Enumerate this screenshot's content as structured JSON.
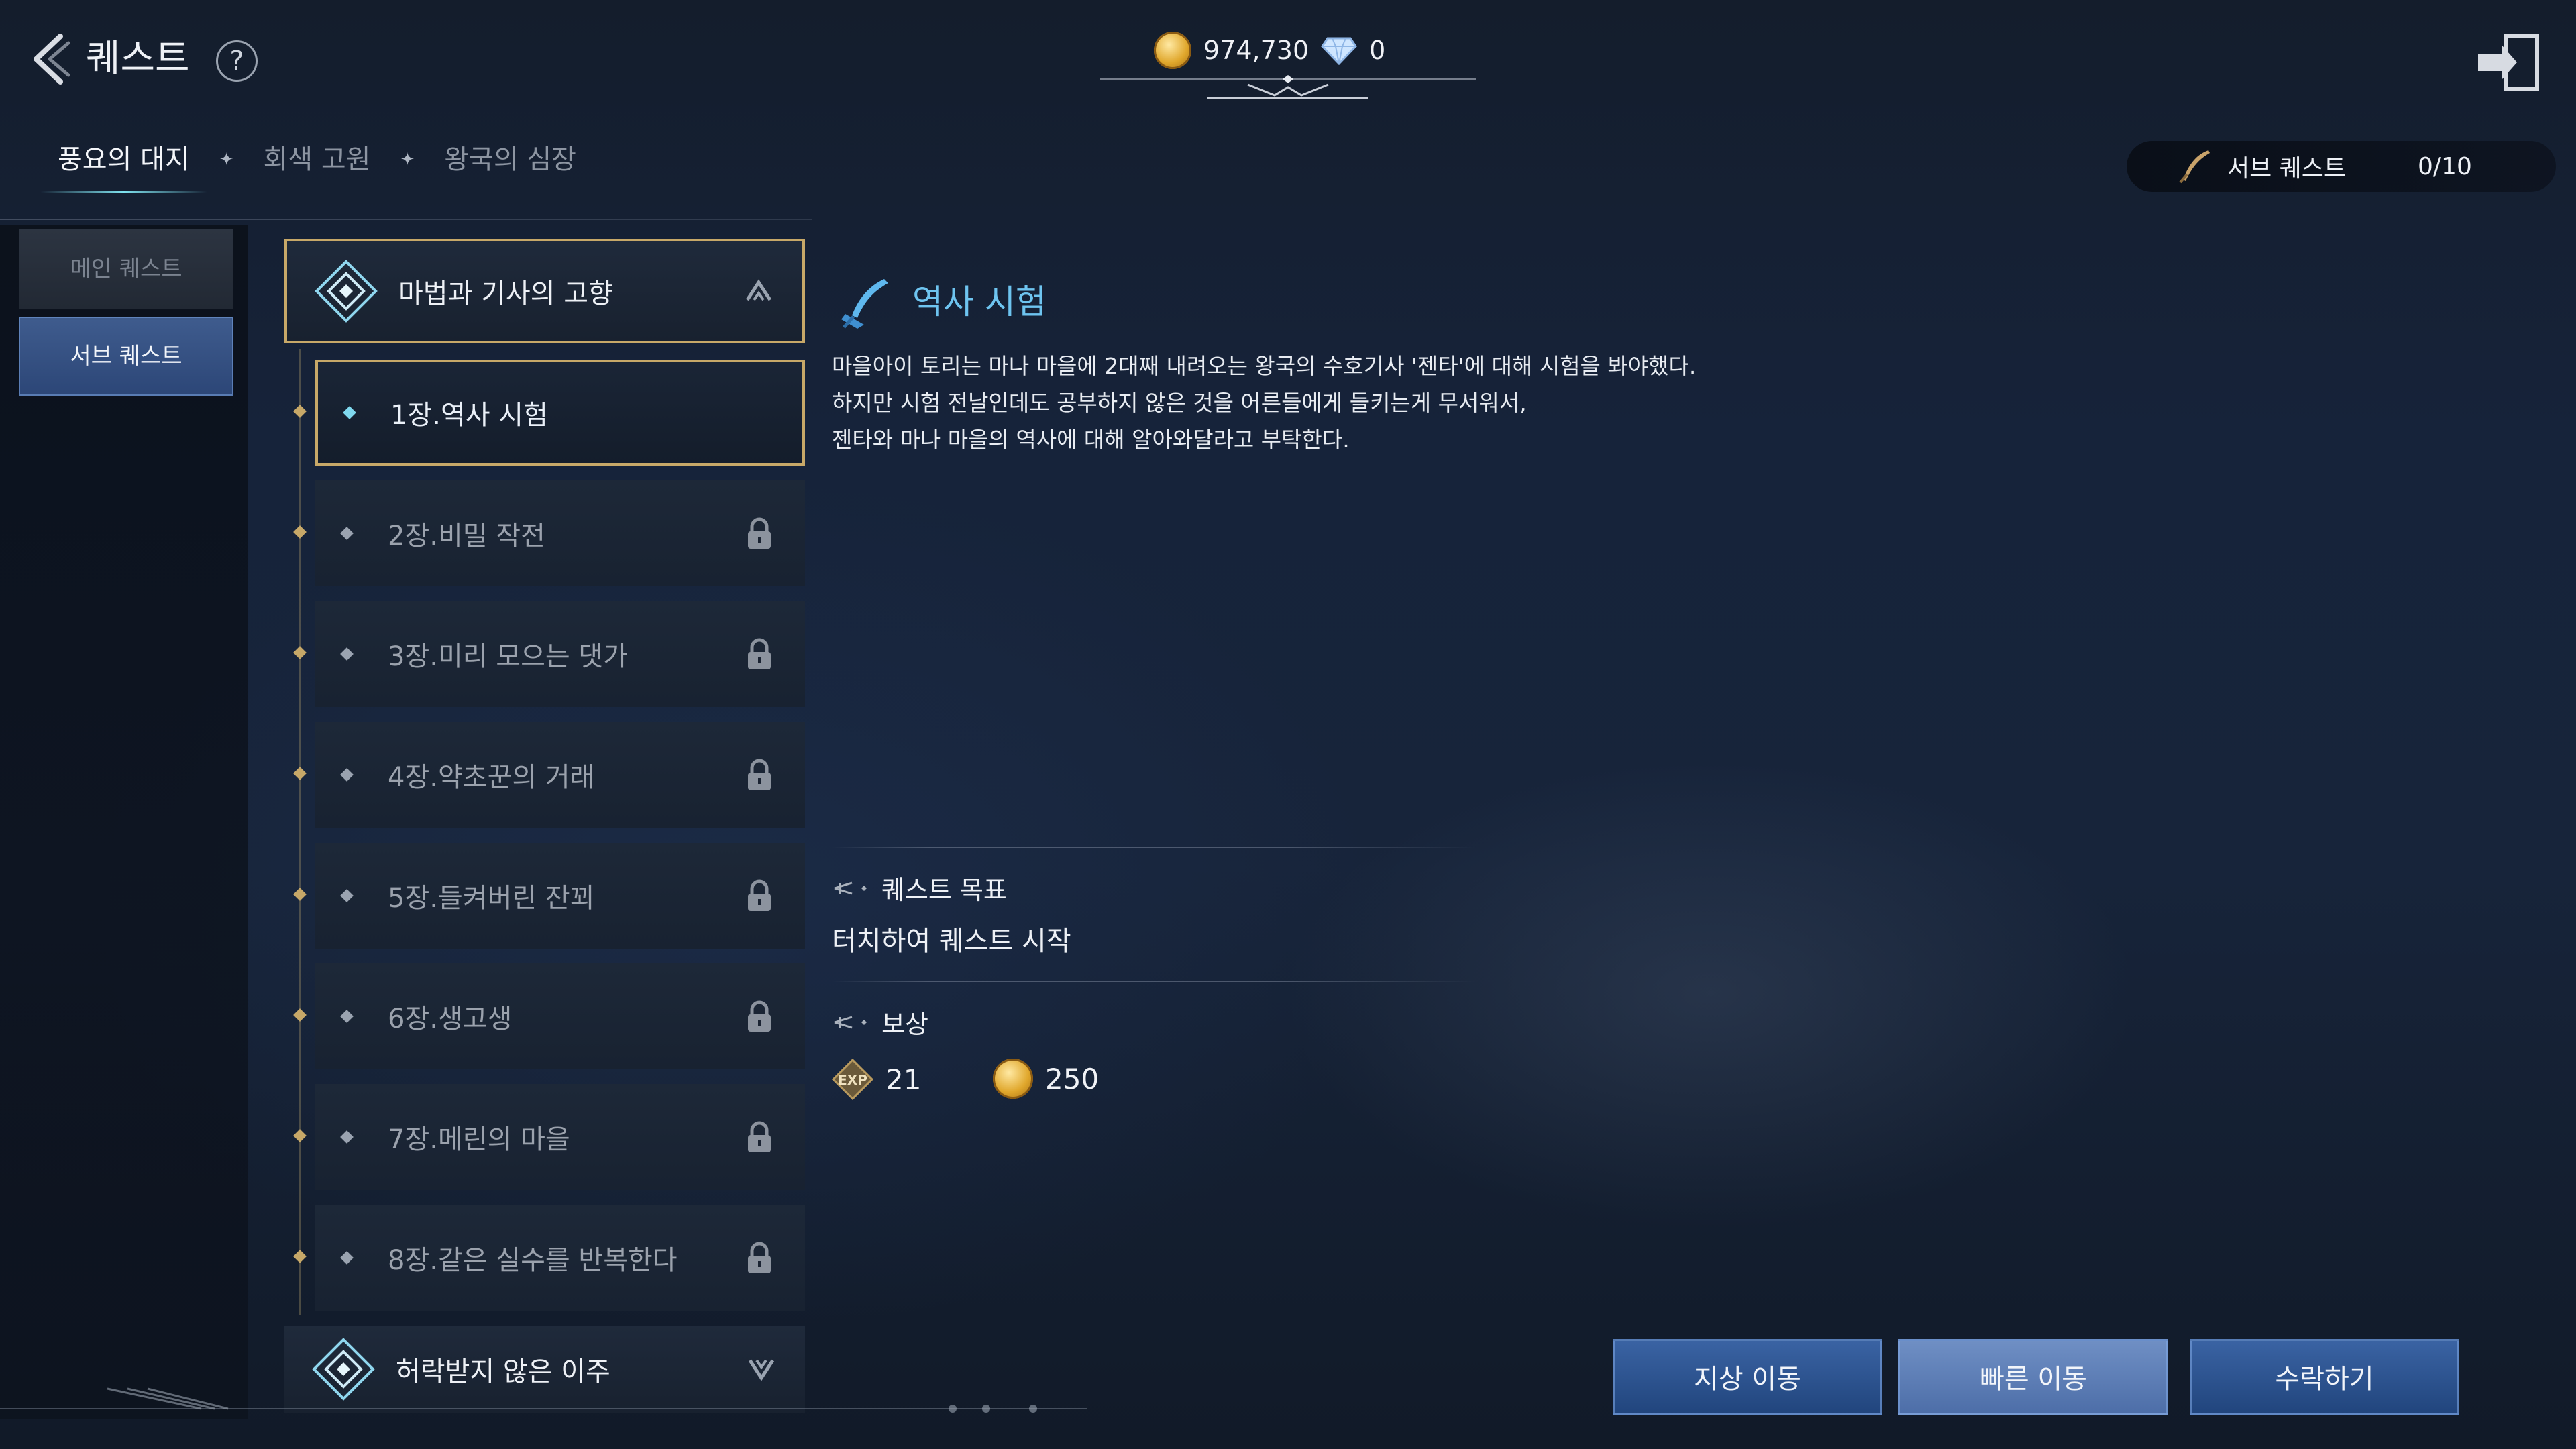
{
  "header": {
    "title": "퀘스트",
    "help_label": "?",
    "gold": "974,730",
    "gems": "0"
  },
  "region_tabs": [
    {
      "label": "풍요의 대지",
      "active": true
    },
    {
      "label": "회색 고원",
      "active": false
    },
    {
      "label": "왕국의 심장",
      "active": false
    }
  ],
  "subquest_counter": {
    "label": "서브 퀘스트",
    "value": "0/10"
  },
  "categories": {
    "main": "메인 퀘스트",
    "sub": "서브 퀘스트"
  },
  "quest_groups": [
    {
      "name": "마법과 기사의 고향",
      "expanded": true
    },
    {
      "name": "허락받지 않은 이주",
      "expanded": false
    }
  ],
  "chapters": [
    {
      "label": "1장.역사 시험",
      "locked": false,
      "selected": true
    },
    {
      "label": "2장.비밀 작전",
      "locked": true
    },
    {
      "label": "3장.미리 모으는 댓가",
      "locked": true
    },
    {
      "label": "4장.약초꾼의 거래",
      "locked": true
    },
    {
      "label": "5장.들켜버린 잔꾀",
      "locked": true
    },
    {
      "label": "6장.생고생",
      "locked": true
    },
    {
      "label": "7장.메린의 마을",
      "locked": true
    },
    {
      "label": "8장.같은 실수를 반복한다",
      "locked": true
    }
  ],
  "detail": {
    "title": "역사 시험",
    "description": [
      "마을아이 토리는 마나 마을에 2대째 내려오는 왕국의 수호기사 '젠타'에 대해 시험을 봐야했다.",
      "하지만 시험 전날인데도 공부하지 않은 것을 어른들에게 들키는게 무서워서,",
      "젠타와 마나 마을의 역사에 대해 알아와달라고 부탁한다."
    ],
    "objective_title": "퀘스트 목표",
    "objective": "터치하여 퀘스트 시작",
    "reward_title": "보상",
    "reward_exp_label": "EXP",
    "reward_exp": "21",
    "reward_gold": "250"
  },
  "buttons": {
    "ground_move": "지상 이동",
    "fast_move": "빠른 이동",
    "accept": "수락하기"
  },
  "colors": {
    "accent_gold": "#c7a868",
    "title_blue": "#6ec4f0",
    "button_blue": "#2d5190"
  }
}
